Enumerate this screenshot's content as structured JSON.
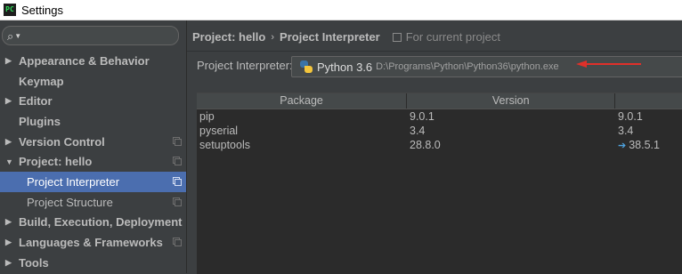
{
  "window": {
    "title": "Settings",
    "app_icon_text": "PC"
  },
  "sidebar": {
    "search_placeholder": "",
    "items": [
      {
        "label": "Appearance & Behavior",
        "arrow": "▶",
        "bold": true
      },
      {
        "label": "Keymap",
        "arrow": "",
        "bold": true
      },
      {
        "label": "Editor",
        "arrow": "▶",
        "bold": true
      },
      {
        "label": "Plugins",
        "arrow": "",
        "bold": true
      },
      {
        "label": "Version Control",
        "arrow": "▶",
        "bold": true
      },
      {
        "label": "Project: hello",
        "arrow": "▼",
        "bold": true
      },
      {
        "label": "Project Interpreter",
        "arrow": "",
        "bold": false,
        "selected": true
      },
      {
        "label": "Project Structure",
        "arrow": "",
        "bold": false
      },
      {
        "label": "Build, Execution, Deployment",
        "arrow": "▶",
        "bold": true
      },
      {
        "label": "Languages & Frameworks",
        "arrow": "▶",
        "bold": true
      },
      {
        "label": "Tools",
        "arrow": "▶",
        "bold": true
      }
    ]
  },
  "breadcrumb": {
    "parent": "Project: hello",
    "separator": "›",
    "current": "Project Interpreter",
    "scope": "For current project"
  },
  "interpreter": {
    "label": "Project Interpreter:",
    "name": "Python 3.6",
    "path": "D:\\Programs\\Python\\Python36\\python.exe",
    "annotation_color": "#e0302a"
  },
  "packages": {
    "headers": [
      "Package",
      "Version",
      ""
    ],
    "rows": [
      {
        "package": "pip",
        "version": "9.0.1",
        "latest": "9.0.1",
        "upgrade": false
      },
      {
        "package": "pyserial",
        "version": "3.4",
        "latest": "3.4",
        "upgrade": false
      },
      {
        "package": "setuptools",
        "version": "28.8.0",
        "latest": "38.5.1",
        "upgrade": true
      }
    ]
  }
}
